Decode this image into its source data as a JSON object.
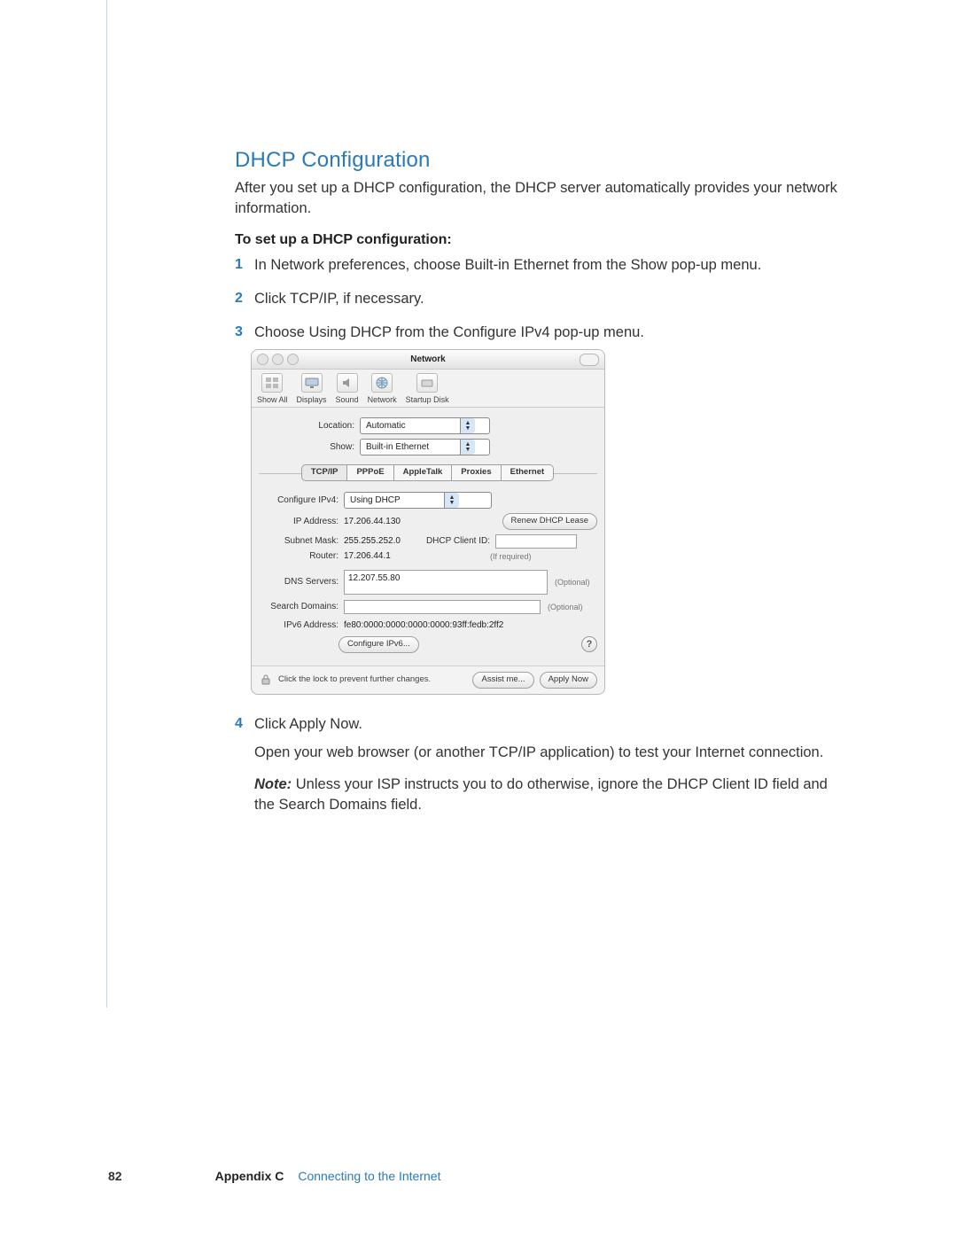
{
  "heading": "DHCP Configuration",
  "intro": "After you set up a DHCP configuration, the DHCP server automatically provides your network information.",
  "procedure_title": "To set up a DHCP configuration:",
  "steps": {
    "s1": "In Network preferences, choose Built-in Ethernet from the Show pop-up menu.",
    "s2": "Click TCP/IP, if necessary.",
    "s3": "Choose Using DHCP from the Configure IPv4 pop-up menu.",
    "s4": "Click Apply Now.",
    "post4a": "Open your web browser (or another TCP/IP application) to test your Internet connection.",
    "note_lead": "Note:",
    "note_body": "  Unless your ISP instructs you to do otherwise, ignore the DHCP Client ID field and the Search Domains field."
  },
  "window": {
    "title": "Network",
    "toolbar": {
      "show_all": "Show All",
      "displays": "Displays",
      "sound": "Sound",
      "network": "Network",
      "startup": "Startup Disk"
    },
    "location_label": "Location:",
    "location_value": "Automatic",
    "show_label": "Show:",
    "show_value": "Built-in Ethernet",
    "tabs": {
      "t1": "TCP/IP",
      "t2": "PPPoE",
      "t3": "AppleTalk",
      "t4": "Proxies",
      "t5": "Ethernet"
    },
    "config_label": "Configure IPv4:",
    "config_value": "Using DHCP",
    "renew_btn": "Renew DHCP Lease",
    "ip_label": "IP Address:",
    "ip_value": "17.206.44.130",
    "subnet_label": "Subnet Mask:",
    "subnet_value": "255.255.252.0",
    "router_label": "Router:",
    "router_value": "17.206.44.1",
    "client_label": "DHCP Client ID:",
    "client_hint": "(If required)",
    "dns_label": "DNS Servers:",
    "dns_value": "12.207.55.80",
    "search_label": "Search Domains:",
    "optional": "(Optional)",
    "ipv6_label": "IPv6 Address:",
    "ipv6_value": "fe80:0000:0000:0000:0000:93ff:fedb:2ff2",
    "config_ipv6_btn": "Configure IPv6...",
    "lock_text": "Click the lock to prevent further changes.",
    "assist_btn": "Assist me...",
    "apply_btn": "Apply Now"
  },
  "footer": {
    "page": "82",
    "appendix": "Appendix C",
    "chapter": "Connecting to the Internet"
  }
}
